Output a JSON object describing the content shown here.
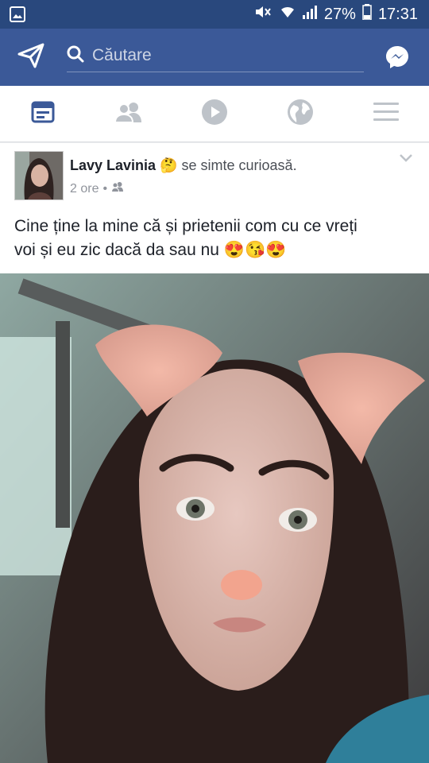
{
  "status_bar": {
    "battery": "27%",
    "time": "17:31"
  },
  "top_bar": {
    "search_placeholder": "Căutare"
  },
  "nav_tabs": [
    {
      "icon": "news-feed-icon",
      "active": true
    },
    {
      "icon": "friends-icon",
      "active": false
    },
    {
      "icon": "video-icon",
      "active": false
    },
    {
      "icon": "globe-icon",
      "active": false
    },
    {
      "icon": "menu-icon",
      "active": false
    }
  ],
  "post": {
    "author": "Lavy Lavinia",
    "feeling_emoji": "🤔",
    "feeling": "se simte curioasă.",
    "time": "2 ore",
    "separator": "•",
    "text_line1": "Cine ține la mine că și prietenii com cu ce vreți",
    "text_line2": "voi și eu zic dacă da sau nu",
    "text_emojis": "😍😘😍"
  },
  "colors": {
    "status_bar": "#29487d",
    "top_bar": "#3b5998",
    "tab_active": "#3b5998",
    "tab_inactive": "#bec3c9"
  }
}
